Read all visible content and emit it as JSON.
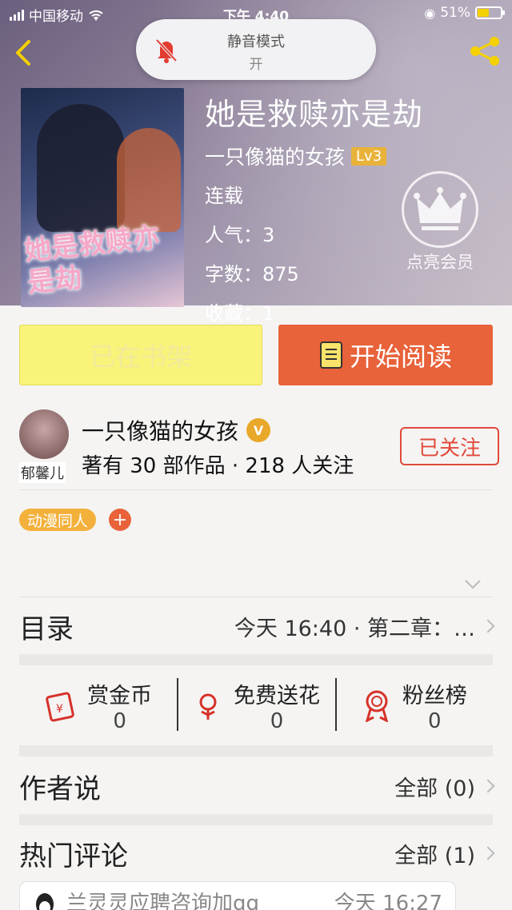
{
  "status_bar": {
    "carrier": "中国移动",
    "time": "下午 4:40",
    "battery": "51%"
  },
  "mute_toast": {
    "title": "静音模式",
    "state": "开"
  },
  "book": {
    "title": "她是救赎亦是劫",
    "author": "一只像猫的女孩",
    "level": "Lv3",
    "status": "连载",
    "popularity_label": "人气：",
    "popularity": "3",
    "words_label": "字数：",
    "words": "875",
    "favorites_label": "收藏：",
    "favorites": "1",
    "cover_title": "她是救赎亦是劫"
  },
  "vip": {
    "label": "点亮会员"
  },
  "buttons": {
    "shelf": "已在书架",
    "read": "开始阅读"
  },
  "author_card": {
    "name": "一只像猫的女孩",
    "verified_badge": "V",
    "avatar_tag": "郁馨儿",
    "stats": "著有 30 部作品 · 218 人关注",
    "follow": "已关注"
  },
  "tags": [
    "动漫同人"
  ],
  "tag_add": "+",
  "toc": {
    "label": "目录",
    "latest": "今天 16:40 · 第二章：…"
  },
  "actions": [
    {
      "label": "赏金币",
      "value": "0",
      "icon": "red-envelope-icon"
    },
    {
      "label": "免费送花",
      "value": "0",
      "icon": "flower-icon"
    },
    {
      "label": "粉丝榜",
      "value": "0",
      "icon": "medal-icon"
    }
  ],
  "author_say": {
    "label": "作者说",
    "link": "全部 (0)"
  },
  "hot_comments": {
    "label": "热门评论",
    "link": "全部 (1)"
  },
  "comment_preview": {
    "user": "兰灵灵应聘咨询加qq",
    "time": "今天 16:27"
  },
  "colors": {
    "accent": "#e8623a",
    "shelf_bg": "#f9f37a",
    "tag": "#f3b13c",
    "follow": "#e1493a"
  }
}
